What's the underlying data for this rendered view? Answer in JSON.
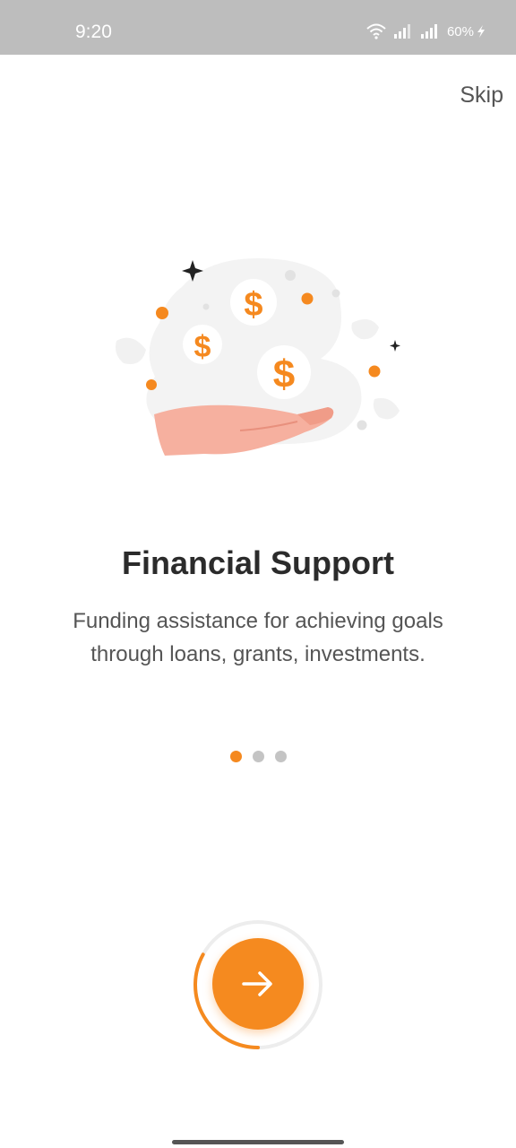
{
  "status_bar": {
    "time": "9:20",
    "battery": "60%"
  },
  "header": {
    "skip_label": "Skip"
  },
  "onboarding": {
    "title": "Financial Support",
    "description": "Funding assistance for achieving goals through loans, grants, investments.",
    "illustration": "hand-with-dollar-coins",
    "current_page": 1,
    "total_pages": 3,
    "progress_fraction": 0.33
  },
  "colors": {
    "accent": "#f58a1f",
    "dot_inactive": "#c4c4c4",
    "status_bar": "#bdbdbd"
  },
  "icons": {
    "next": "arrow-right-icon"
  }
}
